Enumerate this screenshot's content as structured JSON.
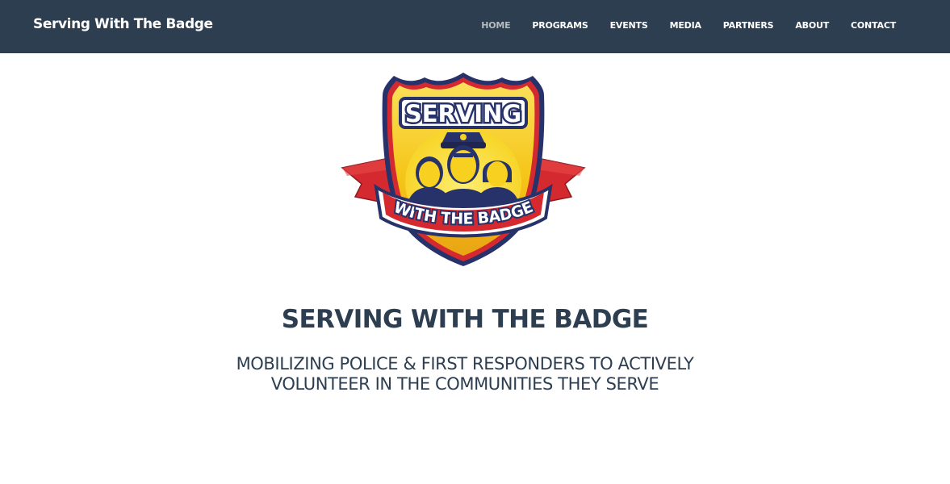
{
  "brand": "Serving With The Badge",
  "nav": {
    "items": [
      {
        "label": "HOME",
        "active": true
      },
      {
        "label": "PROGRAMS"
      },
      {
        "label": "EVENTS"
      },
      {
        "label": "MEDIA"
      },
      {
        "label": "PARTNERS"
      },
      {
        "label": "ABOUT"
      },
      {
        "label": "CONTACT"
      }
    ]
  },
  "logo": {
    "top_text": "SERVING",
    "banner_text": "WITH THE BADGE"
  },
  "hero": {
    "title": "SERVING WITH THE BADGE",
    "subtitle_line1": "MOBILIZING POLICE & FIRST RESPONDERS TO ACTIVELY",
    "subtitle_line2": "VOLUNTEER IN THE COMMUNITIES THEY SERVE"
  },
  "colors": {
    "navbar": "#2c3e50",
    "text": "#2c3e50",
    "nav_active": "#b4bcc2",
    "badge_outline": "#27326a",
    "badge_red": "#d42a2f",
    "badge_gold": "#f3c316",
    "badge_yellow": "#fde33a"
  }
}
